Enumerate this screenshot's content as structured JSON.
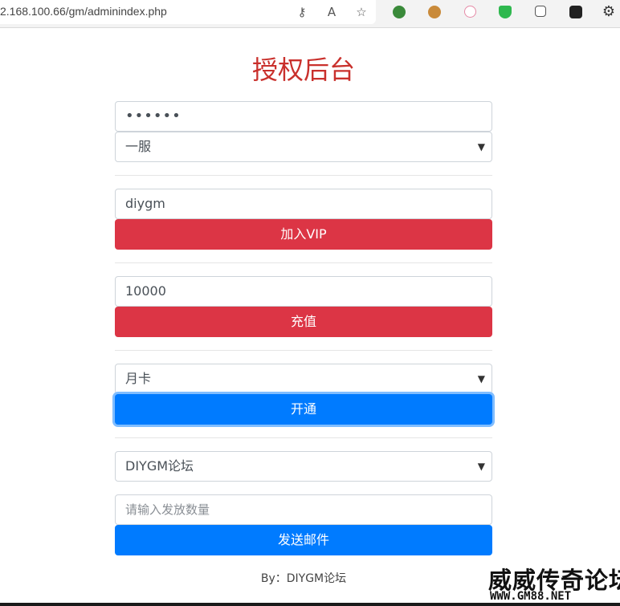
{
  "browser": {
    "url": "2.168.100.66/gm/adminindex.php",
    "icons": [
      "key-icon",
      "read-aloud-icon",
      "add-favorite-icon"
    ],
    "extensions": [
      "extension-globe-icon",
      "extension-monkey-icon",
      "extension-pig-icon",
      "extension-shield-icon",
      "extension-collections-icon",
      "extension-game-icon",
      "settings-puzzle-icon"
    ]
  },
  "page": {
    "title": "授权后台"
  },
  "form": {
    "password_value": "••••••",
    "server_select": "一服",
    "vip_input": "diygm",
    "vip_button": "加入VIP",
    "recharge_input": "10000",
    "recharge_button": "充值",
    "card_select": "月卡",
    "card_button": "开通",
    "mail_select": "DIYGM论坛",
    "mail_quantity_placeholder": "请输入发放数量",
    "mail_button": "发送邮件"
  },
  "footer": {
    "text": "By：DIYGM论坛"
  },
  "watermark": {
    "line1": "威威传奇论坛",
    "line2": "WWW.GM88.NET"
  },
  "colors": {
    "title": "#c9302c",
    "danger": "#dc3545",
    "primary": "#007bff"
  }
}
